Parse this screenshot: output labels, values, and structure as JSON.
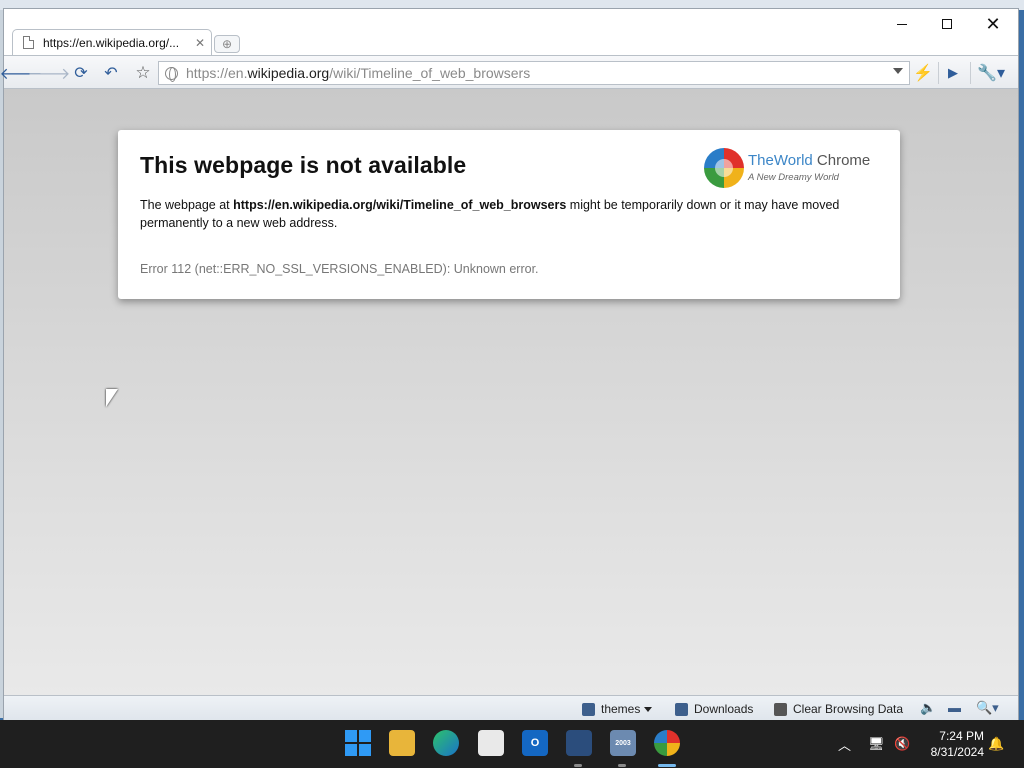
{
  "tab": {
    "title": "https://en.wikipedia.org/..."
  },
  "addressbar": {
    "url_prefix": "https://en.",
    "url_host": "wikipedia.org",
    "url_path": "/wiki/Timeline_of_web_browsers"
  },
  "error": {
    "title": "This webpage is not available",
    "desc_before": "The webpage at ",
    "desc_url": "https://en.wikipedia.org/wiki/Timeline_of_web_browsers",
    "desc_after": " might be temporarily down or it may have moved permanently to a new web address.",
    "code": "Error 112 (net::ERR_NO_SSL_VERSIONS_ENABLED): Unknown error."
  },
  "logo": {
    "name_part1": "TheWorld",
    "name_part2": " Chrome",
    "tagline": "A New Dreamy World"
  },
  "statusbar": {
    "themes": "themes",
    "downloads": "Downloads",
    "clear": "Clear Browsing Data"
  },
  "taskbar": {
    "vm_label": "2003",
    "time": "7:24 PM",
    "date": "8/31/2024"
  },
  "icons": {
    "back": "back-arrow-icon",
    "forward": "forward-arrow-icon",
    "reload": "reload-icon",
    "undo": "undo-icon",
    "star": "star-icon",
    "bolt": "lightning-icon",
    "play": "play-icon",
    "wrench": "wrench-icon"
  },
  "colors": {
    "accent_blue": "#2f5d9a",
    "logo_blue": "#3c86c7",
    "taskbar": "#1f1f1f"
  }
}
